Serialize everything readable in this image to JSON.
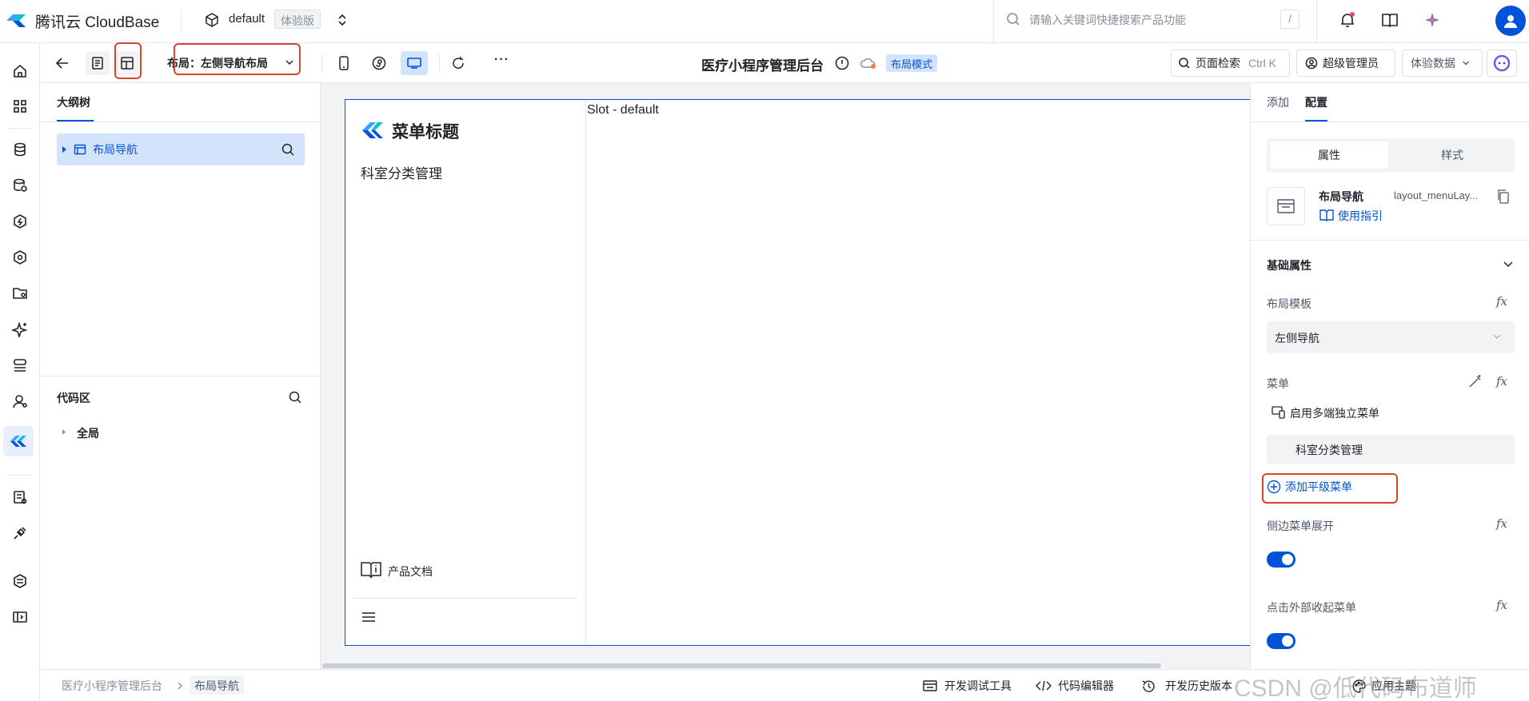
{
  "header": {
    "brand": "腾讯云 CloudBase",
    "env_name": "default",
    "env_badge": "体验版",
    "search_placeholder": "请输入关键词快捷搜索产品功能",
    "search_shortcut": "/"
  },
  "toolbar": {
    "layout_label": "布局：左侧导航布局",
    "app_title": "医疗小程序管理后台",
    "mode_badge": "布局模式",
    "page_search_label": "页面检索",
    "page_search_shortcut": "Ctrl K",
    "admin_label": "超级管理员",
    "data_label": "体验数据",
    "more_label": "···"
  },
  "outline": {
    "tab_label": "大纲树",
    "tree_item_label": "布局导航",
    "code_section_title": "代码区",
    "code_item_label": "全局"
  },
  "canvas": {
    "menu_title": "菜单标题",
    "menu_item": "科室分类管理",
    "slot_label": "Slot - default",
    "docs_label": "产品文档"
  },
  "config": {
    "tabs": [
      "添加",
      "配置"
    ],
    "active_tab": "配置",
    "seg_tabs": [
      "属性",
      "样式"
    ],
    "component_name": "布局导航",
    "component_id": "layout_menuLay...",
    "guide_label": "使用指引",
    "section_title": "基础属性",
    "layout_template_label": "布局模板",
    "layout_template_value": "左侧导航",
    "menu_label": "菜单",
    "multi_menu_label": "启用多端独立菜单",
    "menu_entry": "科室分类管理",
    "add_menu_label": "添加平级菜单",
    "side_expand_label": "侧边菜单展开",
    "side_expand_on": true,
    "click_collapse_label": "点击外部收起菜单",
    "click_collapse_on": true,
    "fx_label": "fx"
  },
  "footer": {
    "breadcrumb": [
      "医疗小程序管理后台",
      "布局导航"
    ],
    "debug_tool": "开发调试工具",
    "code_editor": "代码编辑器",
    "history": "开发历史版本",
    "theme": "应用主题"
  },
  "watermark": "CSDN @低代码布道师",
  "colors": {
    "accent": "#0052d9",
    "highlight_box": "#d8462a",
    "selected_bg": "#d4e3fc"
  }
}
